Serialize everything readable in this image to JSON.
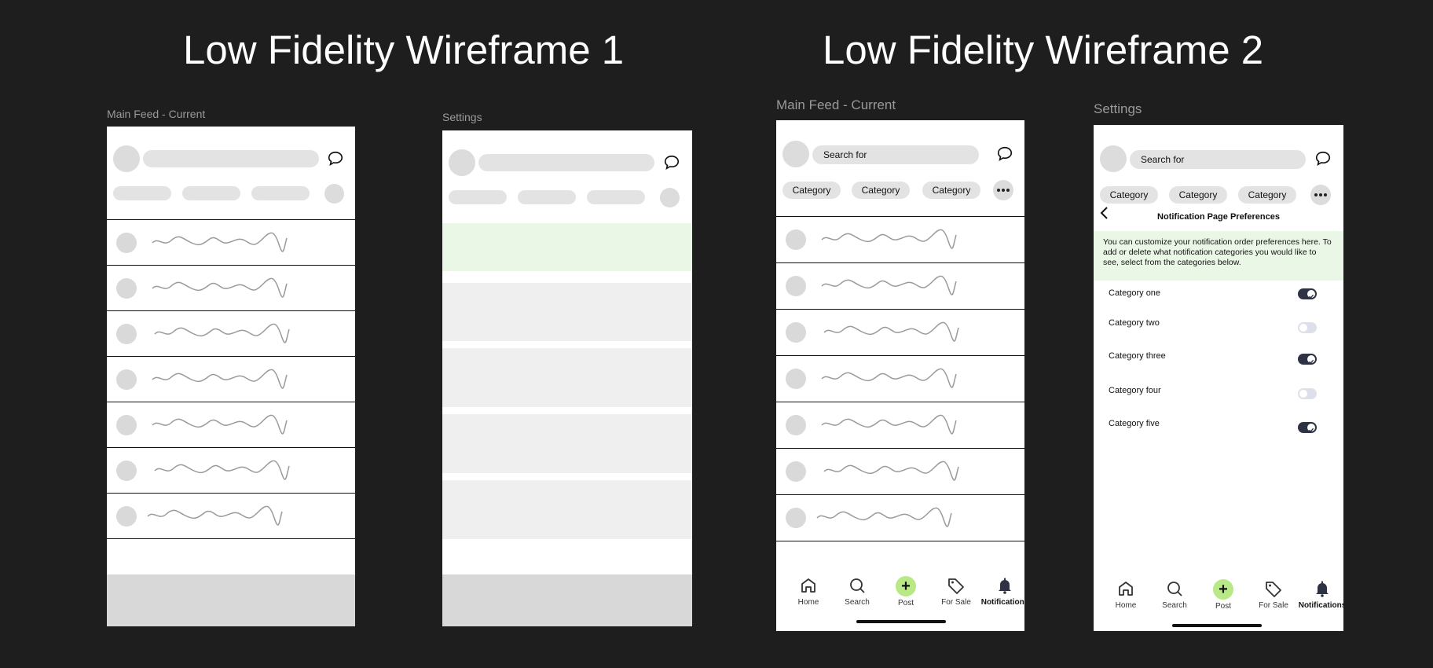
{
  "titles": {
    "wireframe1": "Low Fidelity Wireframe 1",
    "wireframe2": "Low Fidelity Wireframe 2"
  },
  "frame_labels": {
    "w1_main": "Main Feed - Current",
    "w1_settings": "Settings",
    "w2_main": "Main Feed - Current",
    "w2_settings": "Settings"
  },
  "search": {
    "placeholder": "Search for"
  },
  "categories": [
    "Category",
    "Category",
    "Category"
  ],
  "notification_prefs": {
    "title": "Notification Page Preferences",
    "info": "You can customize your notification order preferences here. To add or delete what notification categories you would like to see, select from the categories below.",
    "items": [
      {
        "label": "Category one",
        "enabled": true
      },
      {
        "label": "Category two",
        "enabled": false
      },
      {
        "label": "Category three",
        "enabled": true
      },
      {
        "label": "Category four",
        "enabled": false
      },
      {
        "label": "Category five",
        "enabled": true
      }
    ]
  },
  "tabbar": {
    "tabs": [
      {
        "label": "Home",
        "icon": "home-icon",
        "active": false
      },
      {
        "label": "Search",
        "icon": "search-icon",
        "active": false
      },
      {
        "label": "Post",
        "icon": "plus-icon",
        "active": false
      },
      {
        "label": "For Sale",
        "icon": "tag-icon",
        "active": false
      },
      {
        "label": "Notifications",
        "icon": "bell-icon",
        "active": true
      }
    ]
  },
  "colors": {
    "background": "#1e1e1e",
    "placeholder_gray": "#e3e3e3",
    "highlight_green": "#ebf7e6",
    "post_button_green": "#b8e986",
    "toggle_on": "#2d3345",
    "toggle_off": "#dde0ea"
  }
}
